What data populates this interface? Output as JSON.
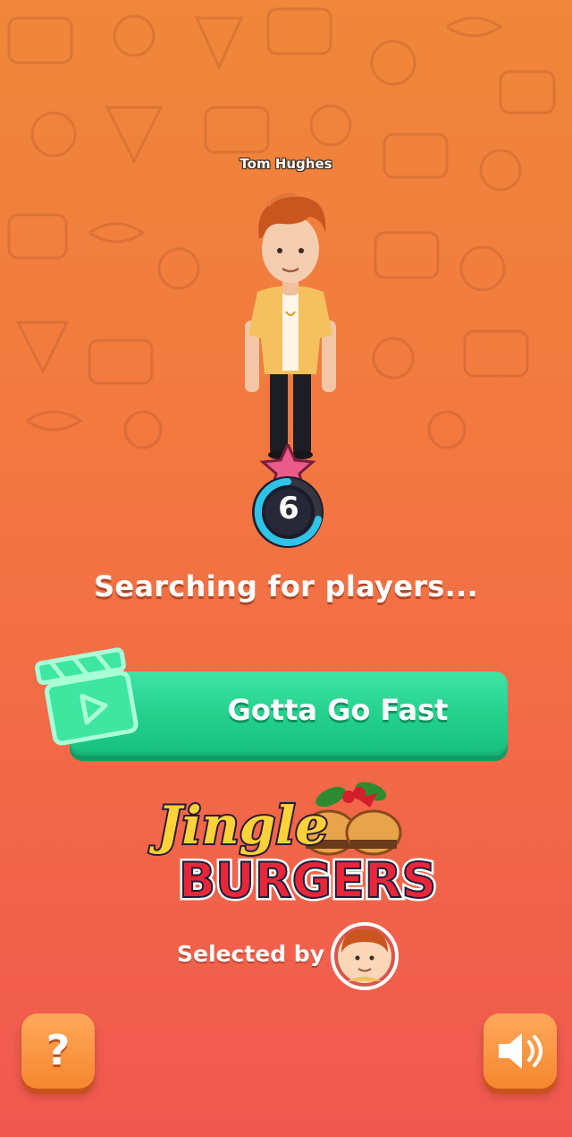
{
  "player": {
    "name": "Tom Hughes",
    "level": "6"
  },
  "status": {
    "text": "Searching for players..."
  },
  "mode": {
    "label": "Gotta Go Fast"
  },
  "game": {
    "title_line1": "Jingle",
    "title_line2": "BURGERS"
  },
  "selection": {
    "label": "Selected by"
  },
  "controls": {
    "help_glyph": "?",
    "help_icon": "question-icon",
    "sound_icon": "speaker-icon"
  },
  "colors": {
    "background_top": "#f0873a",
    "background_bottom": "#f0584f",
    "mode_button": "#22d08c",
    "level_ring": "#2ec4e8"
  }
}
